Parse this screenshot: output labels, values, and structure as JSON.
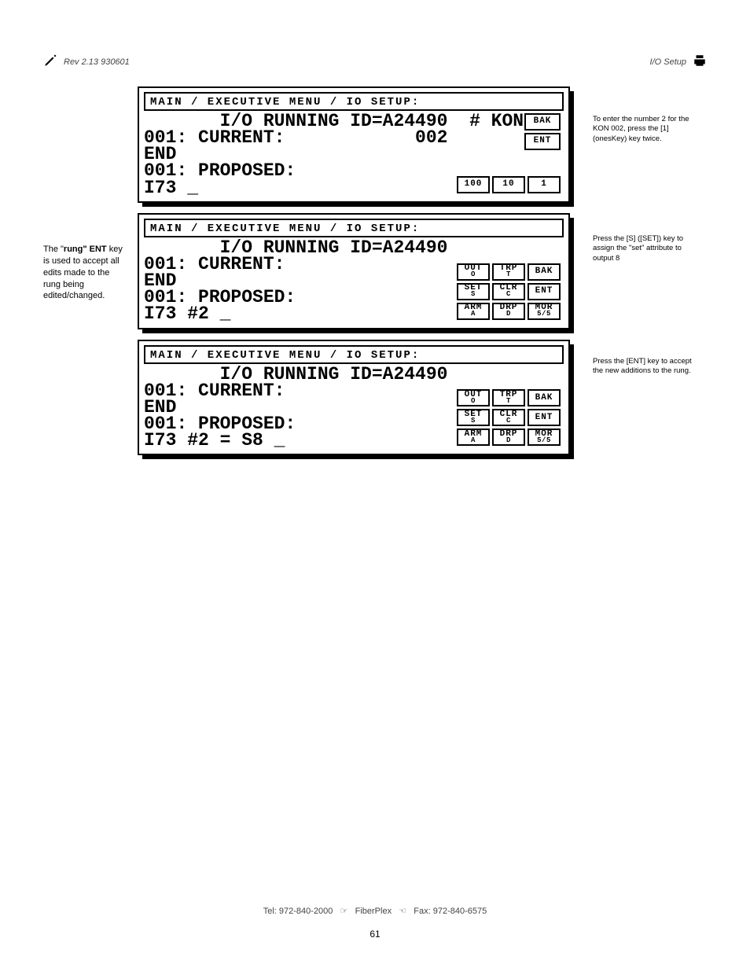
{
  "header": {
    "left_icon": "pencil",
    "left_text": "Rev 2.13 930601",
    "right_text": "I/O Setup",
    "right_icon": "printer"
  },
  "sidenote": {
    "prefix": "The \"",
    "bold": "rung\" ENT",
    "rest": " key is used to accept all edits made to the rung being edited/changed."
  },
  "screens": [
    {
      "breadcrumb": "MAIN / EXECUTIVE MENU / IO SETUP:",
      "body_line1": "       I/O RUNNING ID=A24490  # KON",
      "body_line2": "001: CURRENT:            002",
      "body_line3": "END",
      "body_line4": "001: PROPOSED:",
      "body_line5": "I73 _",
      "keys_top": [
        "BAK",
        "ENT"
      ],
      "keys_bottom": [
        "100",
        "10",
        "1"
      ]
    },
    {
      "breadcrumb": "MAIN / EXECUTIVE MENU / IO SETUP:",
      "body_line1": "       I/O RUNNING ID=A24490",
      "body_line2": "001: CURRENT:",
      "body_line3": "END",
      "body_line4": "001: PROPOSED:",
      "body_line5": "I73 #2 _",
      "keys": [
        {
          "t": "OUT",
          "s": "O"
        },
        {
          "t": "TRP",
          "s": "T"
        },
        {
          "t": "BAK",
          "s": ""
        },
        {
          "t": "SET",
          "s": "S"
        },
        {
          "t": "CLR",
          "s": "C"
        },
        {
          "t": "ENT",
          "s": ""
        },
        {
          "t": "ARM",
          "s": "A"
        },
        {
          "t": "DRP",
          "s": "D"
        },
        {
          "t": "MOR",
          "s": "5/5"
        }
      ]
    },
    {
      "breadcrumb": "MAIN / EXECUTIVE MENU / IO SETUP:",
      "body_line1": "       I/O RUNNING ID=A24490",
      "body_line2": "001: CURRENT:",
      "body_line3": "END",
      "body_line4": "001: PROPOSED:",
      "body_line5": "I73 #2 = S8 _",
      "keys": [
        {
          "t": "OUT",
          "s": "O"
        },
        {
          "t": "TRP",
          "s": "T"
        },
        {
          "t": "BAK",
          "s": ""
        },
        {
          "t": "SET",
          "s": "S"
        },
        {
          "t": "CLR",
          "s": "C"
        },
        {
          "t": "ENT",
          "s": ""
        },
        {
          "t": "ARM",
          "s": "A"
        },
        {
          "t": "DRP",
          "s": "D"
        },
        {
          "t": "MOR",
          "s": "5/5"
        }
      ]
    }
  ],
  "bubbles": [
    "To enter the number 2 for the KON 002, press the [1] (onesKey) key twice.",
    "Press the [S] ([SET]) key to assign the \"set\" attribute to output 8",
    "Press the [ENT] key to accept the new additions to the rung."
  ],
  "footer": {
    "text_left": "Tel: 972-840-2000",
    "hand_left": "pointing-right",
    "center": "FiberPlex",
    "hand_right": "pointing-left",
    "text_right": "Fax: 972-840-6575"
  },
  "page_number": "61"
}
